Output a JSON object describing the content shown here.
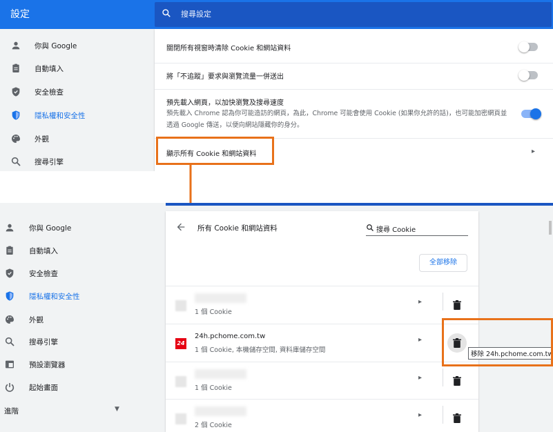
{
  "top": {
    "title": "設定",
    "search_placeholder": "搜尋設定",
    "sidebar": [
      {
        "label": "你與 Google",
        "icon": "person-icon",
        "active": false
      },
      {
        "label": "自動填入",
        "icon": "clipboard-icon",
        "active": false
      },
      {
        "label": "安全檢查",
        "icon": "shield-check-icon",
        "active": false
      },
      {
        "label": "隱私權和安全性",
        "icon": "shield-icon",
        "active": true
      },
      {
        "label": "外觀",
        "icon": "palette-icon",
        "active": false
      },
      {
        "label": "搜尋引擎",
        "icon": "search-icon",
        "active": false
      }
    ],
    "rows": [
      {
        "title": "關閉所有視窗時清除 Cookie 和網站資料",
        "toggle": "off"
      },
      {
        "title": "將「不追蹤」要求與瀏覽流量一併送出",
        "toggle": "off"
      },
      {
        "title": "預先載入網頁，以加快瀏覽及搜尋速度",
        "subtitle": "預先載入 Chrome 認為你可能造訪的網頁，為此，Chrome 可能會使用 Cookie (如果你允許的話)，也可能加密網頁並透過 Google 傳送，以便向網站隱藏你的身分。",
        "toggle": "on"
      },
      {
        "title": "顯示所有 Cookie 和網站資料"
      }
    ]
  },
  "bottom": {
    "sidebar": [
      {
        "label": "你與 Google",
        "icon": "person-icon",
        "active": false
      },
      {
        "label": "自動填入",
        "icon": "clipboard-icon",
        "active": false
      },
      {
        "label": "安全檢查",
        "icon": "shield-check-icon",
        "active": false
      },
      {
        "label": "隱私權和安全性",
        "icon": "shield-icon",
        "active": true
      },
      {
        "label": "外觀",
        "icon": "palette-icon",
        "active": false
      },
      {
        "label": "搜尋引擎",
        "icon": "search-icon",
        "active": false
      },
      {
        "label": "預設瀏覽器",
        "icon": "browser-icon",
        "active": false
      },
      {
        "label": "起始畫面",
        "icon": "power-icon",
        "active": false
      }
    ],
    "advanced_label": "進階",
    "page_title": "所有 Cookie 和網站資料",
    "search_value": "搜尋 Cookie",
    "remove_all_label": "全部移除",
    "sites": [
      {
        "name": "",
        "desc": "1 個 Cookie",
        "blurred": true
      },
      {
        "name": "24h.pchome.com.tw",
        "desc": "1 個 Cookie, 本機儲存空間, 資料庫儲存空間",
        "blurred": false,
        "favicon_text": "24"
      },
      {
        "name": "",
        "desc": "1 個 Cookie",
        "blurred": true
      },
      {
        "name": "",
        "desc": "2 個 Cookie",
        "blurred": true
      }
    ],
    "tooltip": "移除 24h.pchome.com.tw"
  },
  "colors": {
    "accent": "#1a73e8",
    "highlight": "#e8711a",
    "pchome_red": "#e60012"
  }
}
